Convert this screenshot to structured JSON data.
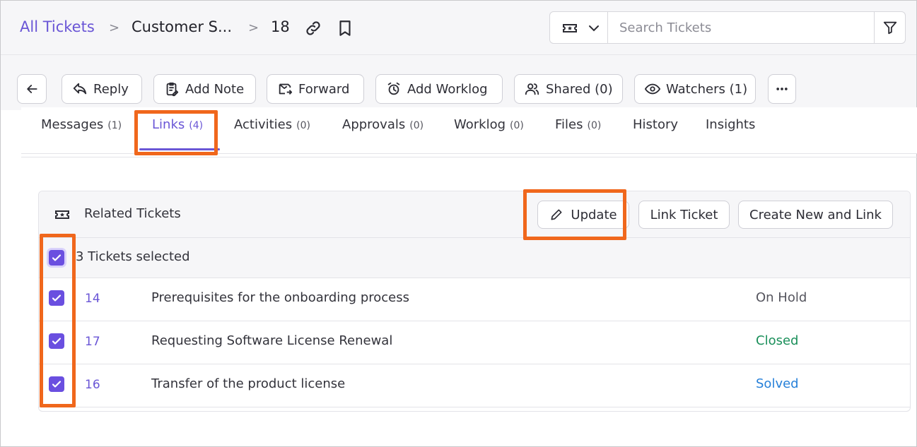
{
  "breadcrumb": {
    "all_tickets": "All Tickets",
    "separator": ">",
    "category": "Customer S...",
    "ticket_number": "18"
  },
  "search": {
    "placeholder": "Search Tickets"
  },
  "toolbar": {
    "reply": "Reply",
    "add_note": "Add Note",
    "forward": "Forward",
    "add_worklog": "Add Worklog",
    "shared": "Shared (0)",
    "watchers": "Watchers (1)"
  },
  "tabs": [
    {
      "label": "Messages",
      "count": "(1)"
    },
    {
      "label": "Links",
      "count": "(4)",
      "active": true
    },
    {
      "label": "Activities",
      "count": "(0)"
    },
    {
      "label": "Approvals",
      "count": "(0)"
    },
    {
      "label": "Worklog",
      "count": "(0)"
    },
    {
      "label": "Files",
      "count": "(0)"
    },
    {
      "label": "History",
      "count": ""
    },
    {
      "label": "Insights",
      "count": ""
    }
  ],
  "related": {
    "title": "Related Tickets",
    "update": "Update",
    "link_ticket": "Link Ticket",
    "create_new_link": "Create New and Link",
    "selected_text": "3 Tickets selected",
    "tickets": [
      {
        "id": "14",
        "subject": "Prerequisites for the onboarding process",
        "status": "On Hold",
        "status_color": "#55555e",
        "selected": true
      },
      {
        "id": "17",
        "subject": "Requesting Software License Renewal",
        "status": "Closed",
        "status_color": "#1a8f5a",
        "selected": true
      },
      {
        "id": "16",
        "subject": "Transfer of the product license",
        "status": "Solved",
        "status_color": "#2680d9",
        "selected": true
      }
    ]
  },
  "colors": {
    "accent": "#6a56d6",
    "highlight": "#f0671c",
    "checkbox": "#6a4fe0"
  }
}
